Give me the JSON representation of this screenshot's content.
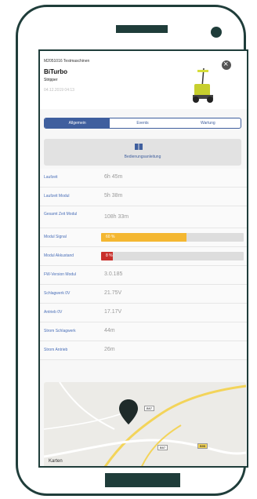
{
  "header": {
    "subtitle": "M2051016 Testmaschinen",
    "title": "BiTurbo",
    "category": "Stripper",
    "date": "04.12.2019 04:13"
  },
  "tabs": [
    {
      "label": "Allgemein",
      "active": true
    },
    {
      "label": "Events",
      "active": false
    },
    {
      "label": "Wartung",
      "active": false
    }
  ],
  "manual": {
    "label": "Bedienungsanleitung",
    "icon": "book-icon"
  },
  "rows": [
    {
      "label": "Laufzeit",
      "value": "6h 45m"
    },
    {
      "label": "Laufzeit Modul",
      "value": "5h 38m"
    },
    {
      "label": "Gesamt Zeit Modul",
      "value": "108h 33m"
    },
    {
      "label": "Modul Signal",
      "bar": {
        "percent": 60,
        "text": "60 %",
        "color": "#f4b731"
      }
    },
    {
      "label": "Modul Akkustand",
      "bar": {
        "percent": 8,
        "text": "8 %",
        "color": "#c9302c"
      }
    },
    {
      "label": "FW-Version Modul",
      "value": "3.0.185"
    },
    {
      "label": "Schlagwerk 0V",
      "value": "21.75V"
    },
    {
      "label": "Antrieb 0V",
      "value": "17.17V"
    },
    {
      "label": "Strom Schlagwerk",
      "value": "44m"
    },
    {
      "label": "Strom Antrieb",
      "value": "26m"
    }
  ],
  "map": {
    "credit": "Karten",
    "road_labels": [
      "B97",
      "B97",
      "B95"
    ]
  },
  "colors": {
    "accent": "#3f5f9e",
    "device_frame": "#1f3d3a"
  }
}
